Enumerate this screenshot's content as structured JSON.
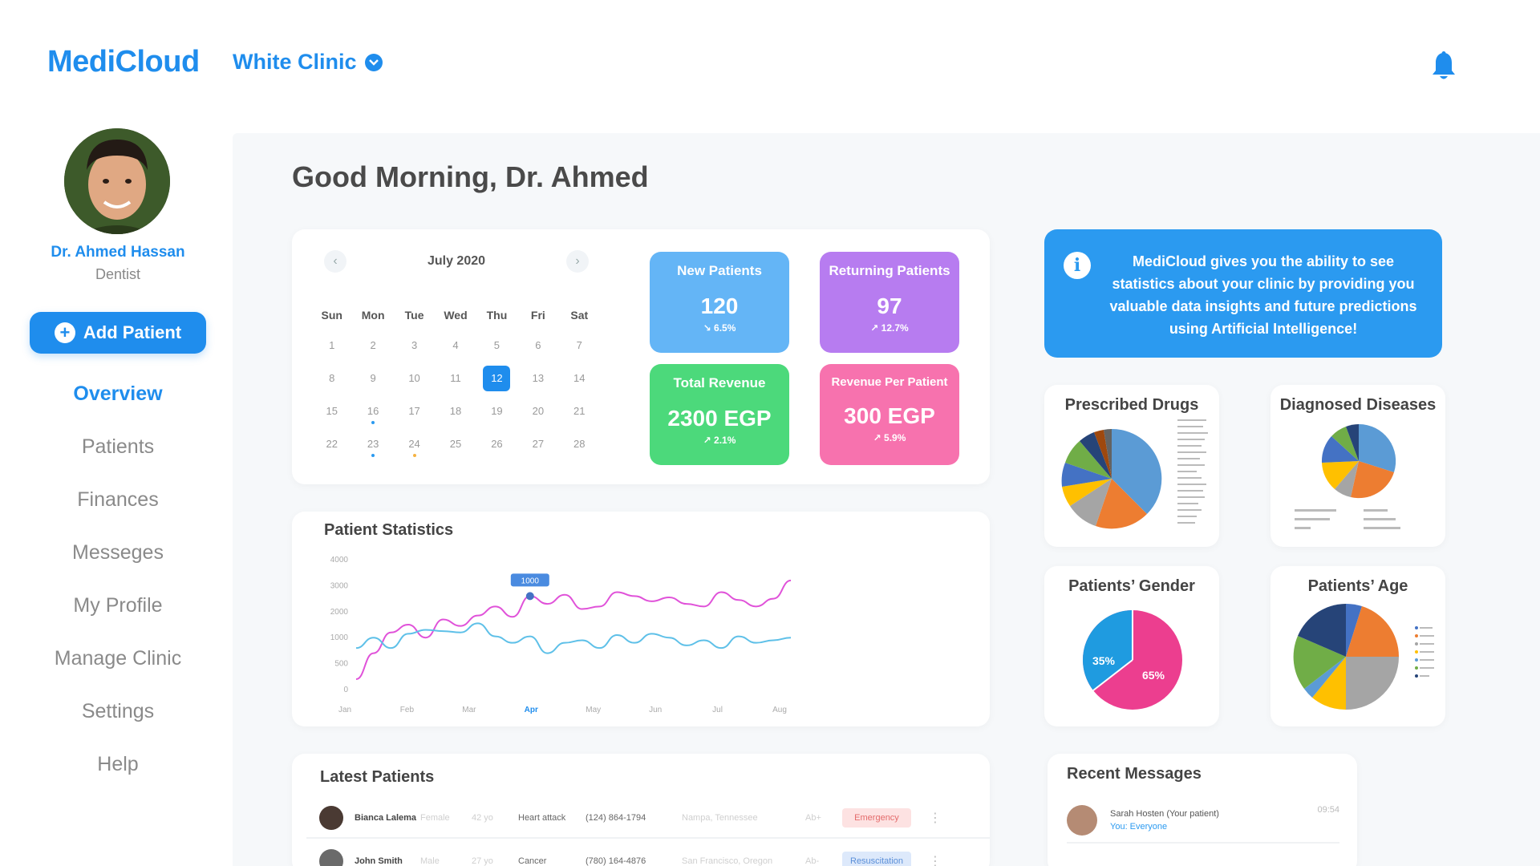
{
  "header": {
    "brand": "MediCloud",
    "clinic_name": "White Clinic"
  },
  "profile": {
    "name": "Dr. Ahmed Hassan",
    "role": "Dentist"
  },
  "sidebar": {
    "add_button": "Add Patient",
    "items": [
      {
        "label": "Overview",
        "active": true
      },
      {
        "label": "Patients"
      },
      {
        "label": "Finances"
      },
      {
        "label": "Messeges"
      },
      {
        "label": "My Profile"
      },
      {
        "label": "Manage Clinic"
      },
      {
        "label": "Settings"
      },
      {
        "label": "Help"
      }
    ]
  },
  "greeting": "Good Morning, Dr. Ahmed",
  "calendar": {
    "month": "July 2020",
    "days_of_week": [
      "Sun",
      "Mon",
      "Tue",
      "Wed",
      "Thu",
      "Fri",
      "Sat"
    ],
    "days": [
      "1",
      "2",
      "3",
      "4",
      "5",
      "6",
      "7",
      "8",
      "9",
      "10",
      "11",
      "12",
      "13",
      "14",
      "15",
      "16",
      "17",
      "18",
      "19",
      "20",
      "21",
      "22",
      "23",
      "24",
      "25",
      "26",
      "27",
      "28"
    ],
    "selected": "12"
  },
  "stats": {
    "new_patients": {
      "label": "New Patients",
      "value": "120",
      "change": "6.5%"
    },
    "returning_patients": {
      "label": "Returning Patients",
      "value": "97",
      "change": "12.7%"
    },
    "total_revenue": {
      "label": "Total Revenue",
      "value": "2300 EGP",
      "change": "2.1%"
    },
    "revenue_per_patient": {
      "label": "Revenue Per Patient",
      "value": "300 EGP",
      "change": "5.9%"
    }
  },
  "colors": {
    "primary": "#1f8ded",
    "new_patients": "#64b5f6",
    "returning_patients": "#b77cf0",
    "total_revenue": "#4cd97b",
    "revenue_per_patient": "#f772ae"
  },
  "info_text": "MediCloud gives you the ability to see statistics about your clinic by providing you valuable data insights and future predictions using Artificial Intelligence!",
  "mini_charts": {
    "prescribed_drugs": "Prescribed Drugs",
    "diagnosed_diseases": "Diagnosed Diseases",
    "patients_gender": "Patients’ Gender",
    "patients_age": "Patients’ Age"
  },
  "gender": {
    "male_label": "35%",
    "female_label": "65%",
    "male": 35,
    "female": 65
  },
  "patient_stats": {
    "title": "Patient Statistics",
    "tooltip": "1000"
  },
  "chart_data": {
    "type": "line",
    "x": [
      "Jan",
      "Feb",
      "Mar",
      "Apr",
      "May",
      "Jun",
      "Jul",
      "Aug"
    ],
    "highlight_x": "Apr",
    "y_ticks": [
      0,
      500,
      1000,
      2000,
      3000,
      4000
    ],
    "series": [
      {
        "color": "#e052d9",
        "values": [
          200,
          700,
          1200,
          1500,
          1000,
          1700,
          1450,
          1850,
          2200,
          1800,
          2600,
          2300,
          2650,
          2100,
          2200,
          2750,
          2600,
          2400,
          2550,
          2300,
          2200,
          2750,
          2450,
          2200,
          2500,
          3200
        ]
      },
      {
        "color": "#5ec0e8",
        "values": [
          800,
          1000,
          800,
          1150,
          1300,
          1250,
          1200,
          1550,
          1050,
          900,
          1050,
          700,
          900,
          950,
          800,
          1100,
          900,
          1150,
          1000,
          850,
          950,
          800,
          1050,
          900,
          950,
          1000
        ]
      }
    ]
  },
  "latest_patients": {
    "title": "Latest Patients",
    "rows": [
      {
        "name": "Bianca Lalema",
        "gender": "Female",
        "age": "42 yo",
        "diagnosis": "Heart attack",
        "phone": "(124) 864-1794",
        "location": "Nampa, Tennessee",
        "blood": "Ab+",
        "status": "Emergency",
        "status_bg": "#fde2e2",
        "status_fg": "#e46b6b"
      },
      {
        "name": "John Smith",
        "gender": "Male",
        "age": "27 yo",
        "diagnosis": "Cancer",
        "phone": "(780) 164-4876",
        "location": "San Francisco, Oregon",
        "blood": "Ab-",
        "status": "Resuscitation",
        "status_bg": "#dde9fb",
        "status_fg": "#5b8fd8"
      }
    ]
  },
  "recent_messages": {
    "title": "Recent Messages",
    "items": [
      {
        "sender": "Sarah Hosten (Your patient)",
        "preview": "You: Everyone",
        "time": "09:54"
      }
    ]
  }
}
